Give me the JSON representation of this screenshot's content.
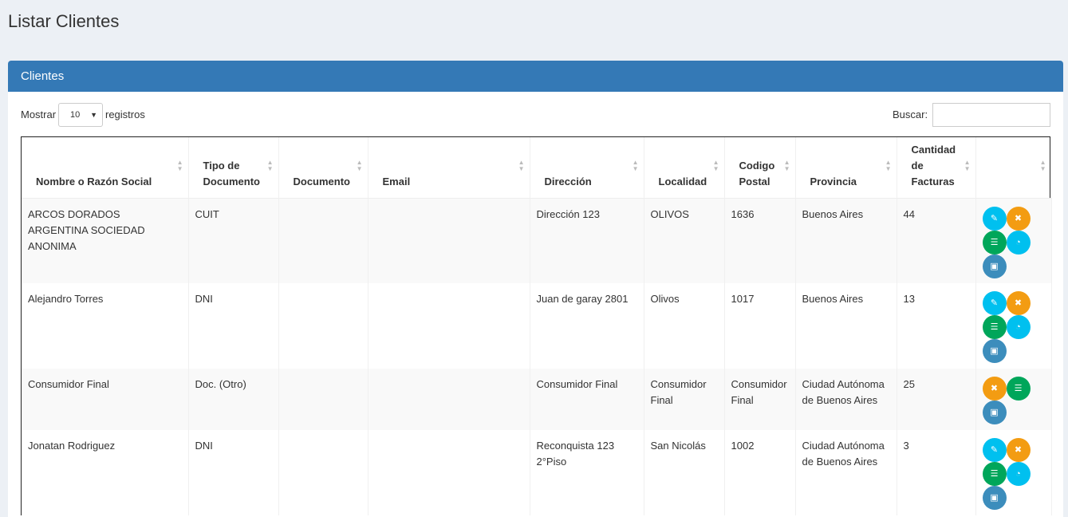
{
  "page": {
    "title": "Listar Clientes"
  },
  "box": {
    "title": "Clientes"
  },
  "controls": {
    "show_label": "Mostrar",
    "length_value": "10",
    "records_label": "registros",
    "search_label": "Buscar:",
    "search_value": ""
  },
  "table": {
    "headers": [
      "Nombre o Razón Social",
      "Tipo de Documento",
      "Documento",
      "Email",
      "Dirección",
      "Localidad",
      "Codigo Postal",
      "Provincia",
      "Cantidad de Facturas",
      ""
    ],
    "rows": [
      {
        "nombre": "ARCOS DORADOS ARGENTINA SOCIEDAD ANONIMA",
        "tipo": "CUIT",
        "documento": "",
        "email": "",
        "direccion": "Dirección 123",
        "localidad": "OLIVOS",
        "cp": "1636",
        "provincia": "Buenos Aires",
        "facturas": "44"
      },
      {
        "nombre": "Alejandro Torres",
        "tipo": "DNI",
        "documento": "",
        "email": "",
        "direccion": "Juan de garay 2801",
        "localidad": "Olivos",
        "cp": "1017",
        "provincia": "Buenos Aires",
        "facturas": "13"
      },
      {
        "nombre": "Consumidor Final",
        "tipo": "Doc. (Otro)",
        "documento": "",
        "email": "",
        "direccion": "Consumidor Final",
        "localidad": "Consumidor Final",
        "cp": "Consumidor Final",
        "provincia": "Ciudad Autónoma de Buenos Aires",
        "facturas": "25"
      },
      {
        "nombre": "Jonatan Rodriguez",
        "tipo": "DNI",
        "documento": "",
        "email": "",
        "direccion": "Reconquista 123 2°Piso",
        "localidad": "San Nicolás",
        "cp": "1002",
        "provincia": "Ciudad Autónoma de Buenos Aires",
        "facturas": "3"
      }
    ]
  },
  "colors": {
    "header_blue": "#3479b6",
    "edit": "#00c0ef",
    "delete": "#f39c12",
    "list": "#00a65a",
    "dashboard": "#00c0ef",
    "money": "#3c8dbc"
  },
  "icons": {
    "edit": "pencil-icon",
    "delete": "close-icon",
    "list": "list-icon",
    "dashboard": "dashboard-icon",
    "money": "money-icon"
  }
}
